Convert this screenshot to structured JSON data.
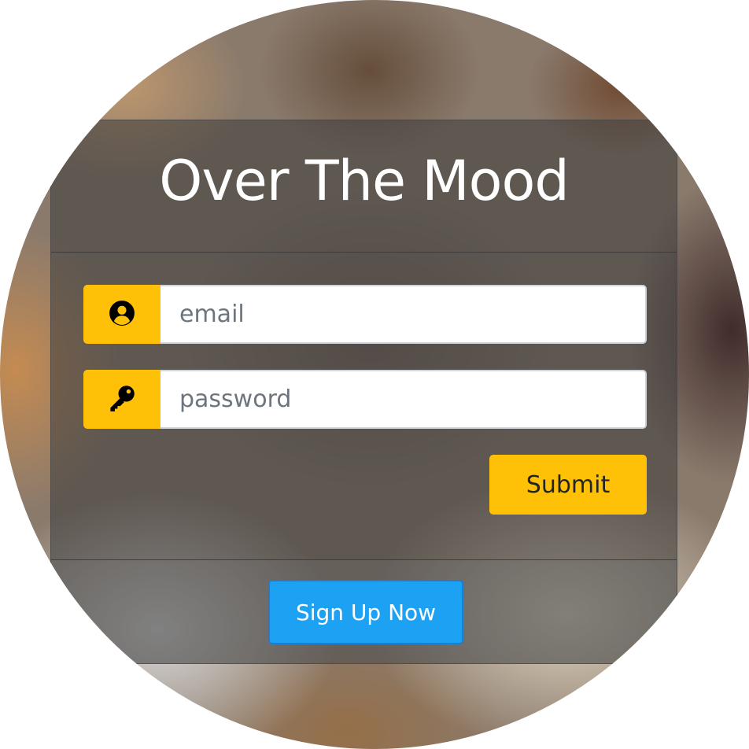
{
  "app": {
    "title": "Over The Mood"
  },
  "login_form": {
    "email": {
      "placeholder": "email",
      "value": "",
      "icon": "user-circle-icon"
    },
    "password": {
      "placeholder": "password",
      "value": "",
      "icon": "key-icon"
    },
    "submit_label": "Submit"
  },
  "footer": {
    "signup_label": "Sign Up Now"
  },
  "colors": {
    "accent": "#ffc107",
    "signup": "#1da1f2",
    "title_text": "#ffffff"
  }
}
